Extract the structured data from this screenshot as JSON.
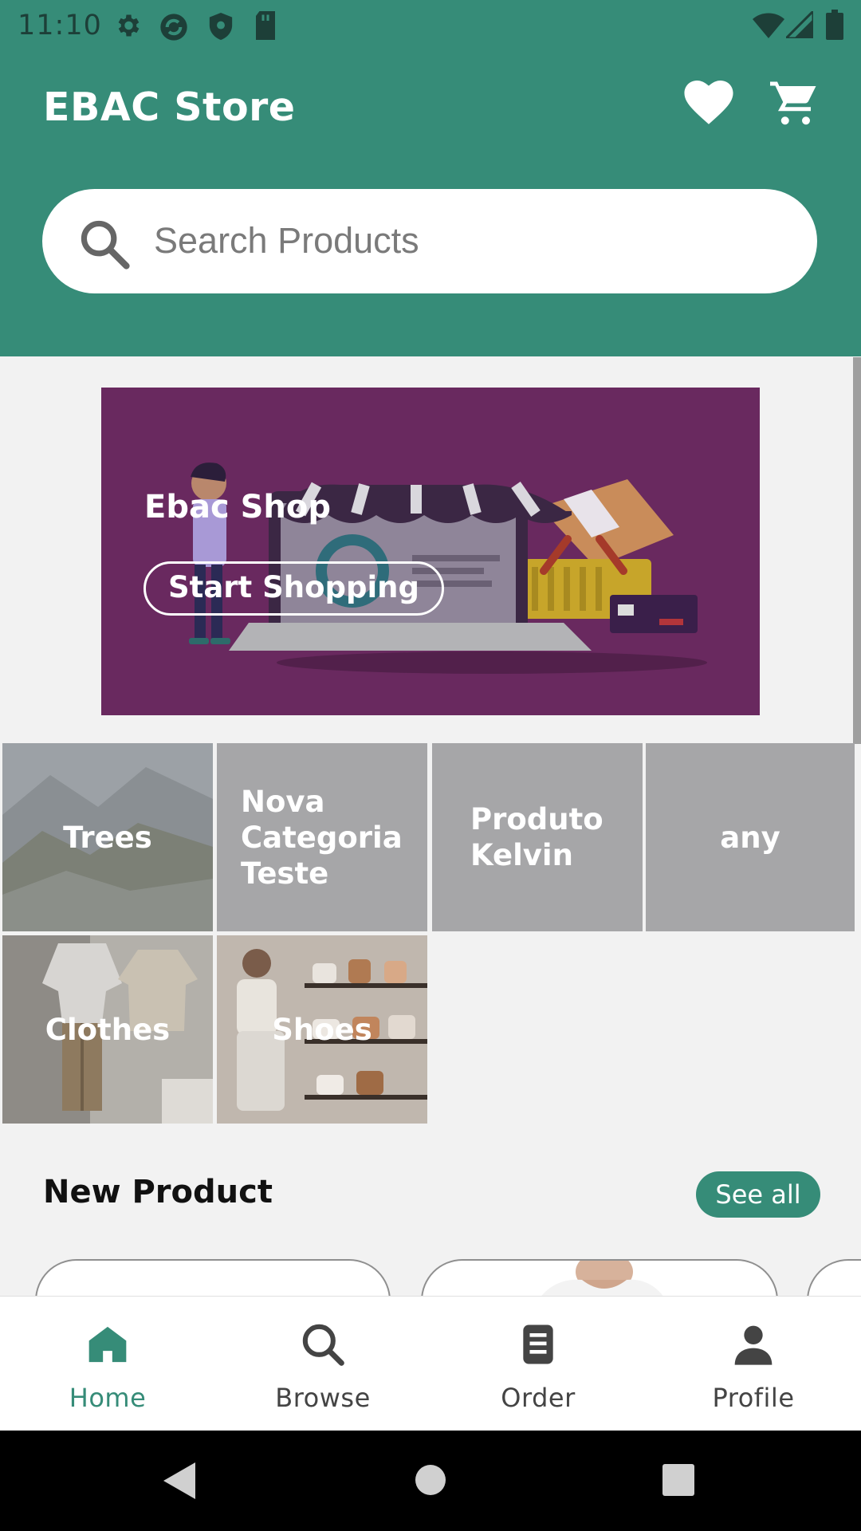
{
  "status_bar": {
    "time": "11:10"
  },
  "header": {
    "title": "EBAC Store",
    "wishlist_icon": "heart-icon",
    "cart_icon": "cart-icon"
  },
  "search": {
    "placeholder": "Search Products"
  },
  "banner": {
    "title": "Ebac Shop",
    "button_label": "Start Shopping"
  },
  "categories": [
    {
      "name": "Trees"
    },
    {
      "name": "Nova Categoria Teste"
    },
    {
      "name": "Produto Kelvin"
    },
    {
      "name": "any"
    },
    {
      "name": "Clothes"
    },
    {
      "name": "Shoes"
    }
  ],
  "new_product": {
    "title": "New Product",
    "see_all_label": "See all"
  },
  "bottom_nav": {
    "items": [
      {
        "label": "Home",
        "icon": "home-icon",
        "active": true
      },
      {
        "label": "Browse",
        "icon": "search-icon",
        "active": false
      },
      {
        "label": "Order",
        "icon": "order-icon",
        "active": false
      },
      {
        "label": "Profile",
        "icon": "profile-icon",
        "active": false
      }
    ]
  },
  "colors": {
    "primary": "#368c78",
    "banner_bg": "#69295f",
    "tile_bg": "#a6a6a8"
  }
}
